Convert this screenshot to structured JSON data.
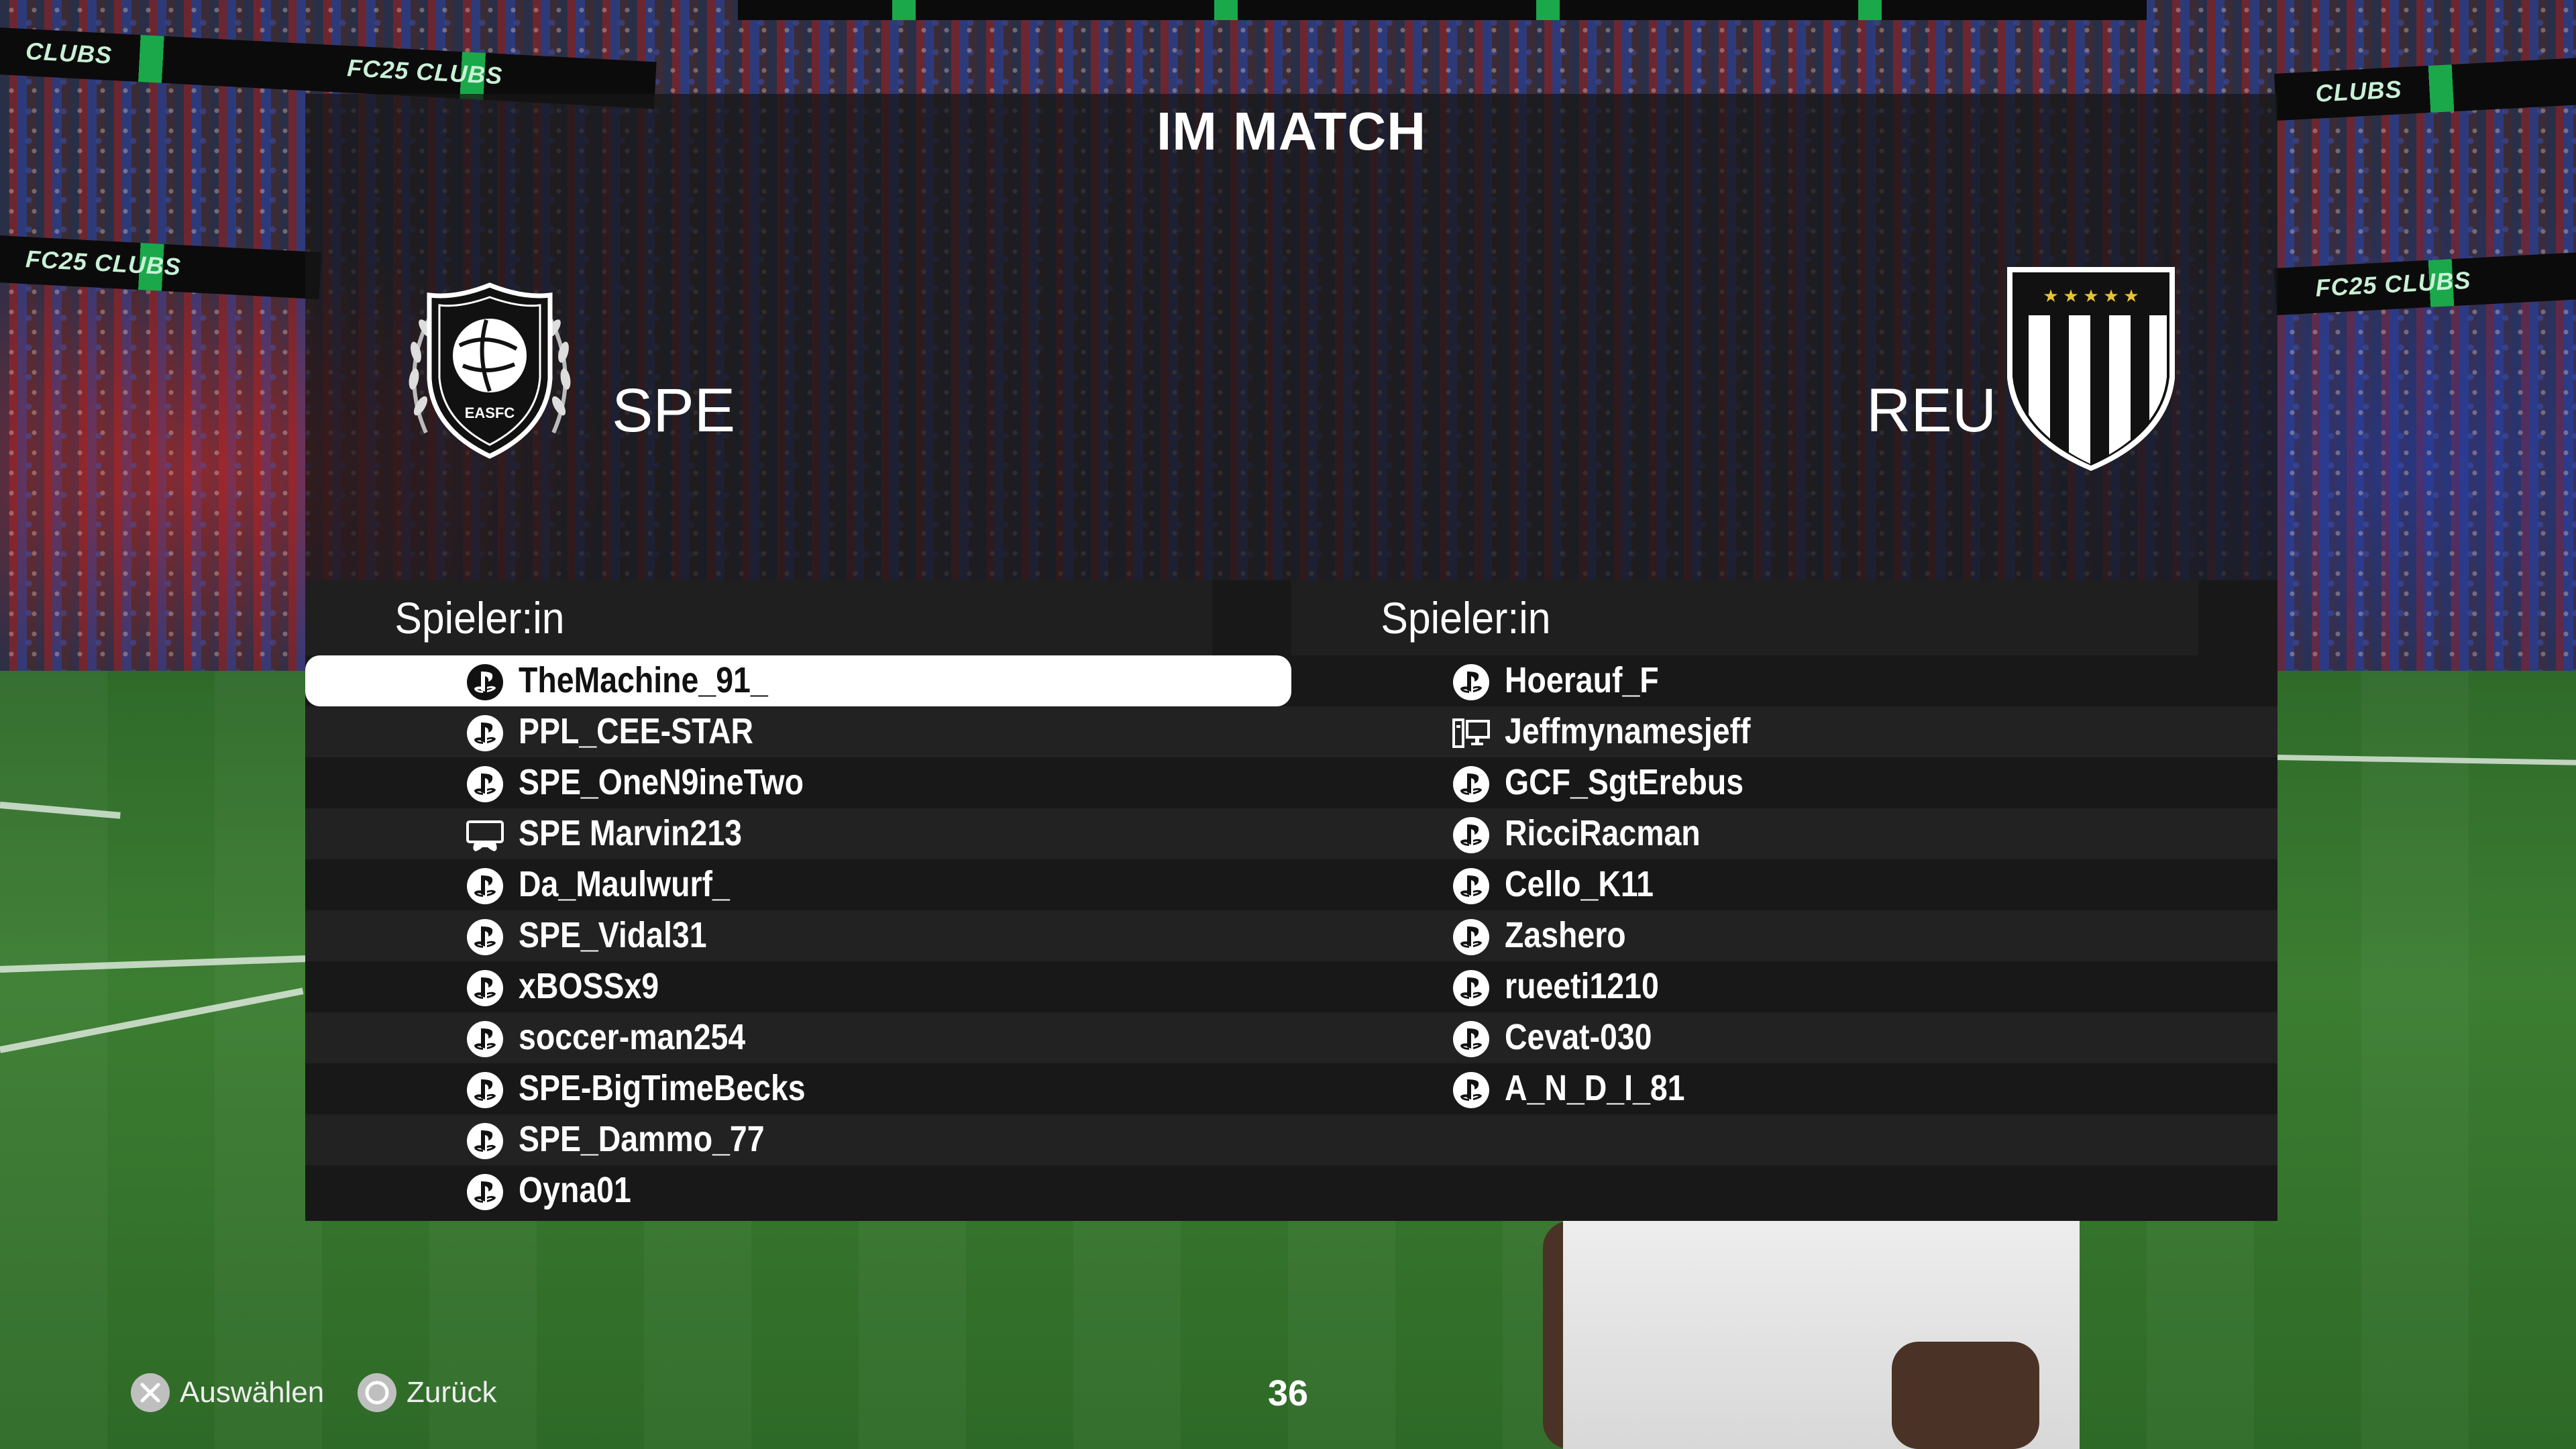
{
  "header": {
    "title": "IM MATCH"
  },
  "ads": {
    "brand": "FC25 CLUBS",
    "fragment": "CLUBS"
  },
  "teams": {
    "home": {
      "abbr": "SPE",
      "crest_text": "EASFC"
    },
    "away": {
      "abbr": "REU"
    }
  },
  "lists": {
    "home": {
      "header": "Spieler:in",
      "players": [
        {
          "name": "TheMachine_91_",
          "platform": "playstation-icon",
          "selected": true
        },
        {
          "name": "PPL_CEE-STAR",
          "platform": "playstation-icon"
        },
        {
          "name": "SPE_OneN9ineTwo",
          "platform": "playstation-icon"
        },
        {
          "name": "SPE Marvin213",
          "platform": "controller-icon"
        },
        {
          "name": "Da_Maulwurf_",
          "platform": "playstation-icon"
        },
        {
          "name": "SPE_Vidal31",
          "platform": "playstation-icon"
        },
        {
          "name": "xBOSSx9",
          "platform": "playstation-icon"
        },
        {
          "name": "soccer-man254",
          "platform": "playstation-icon"
        },
        {
          "name": "SPE-BigTimeBecks",
          "platform": "playstation-icon"
        },
        {
          "name": "SPE_Dammo_77",
          "platform": "playstation-icon"
        },
        {
          "name": "Oyna01",
          "platform": "playstation-icon"
        }
      ]
    },
    "away": {
      "header": "Spieler:in",
      "players": [
        {
          "name": "Hoerauf_F",
          "platform": "playstation-icon"
        },
        {
          "name": "Jeffmynamesjeff",
          "platform": "pc-icon"
        },
        {
          "name": "GCF_SgtErebus",
          "platform": "playstation-icon"
        },
        {
          "name": "RicciRacman",
          "platform": "playstation-icon"
        },
        {
          "name": "Cello_K11",
          "platform": "playstation-icon"
        },
        {
          "name": "Zashero",
          "platform": "playstation-icon"
        },
        {
          "name": "rueeti1210",
          "platform": "playstation-icon"
        },
        {
          "name": "Cevat-030",
          "platform": "playstation-icon"
        },
        {
          "name": "A_N_D_I_81",
          "platform": "playstation-icon"
        }
      ]
    }
  },
  "footer": {
    "select_label": "Auswählen",
    "back_label": "Zurück",
    "timer": "36"
  }
}
